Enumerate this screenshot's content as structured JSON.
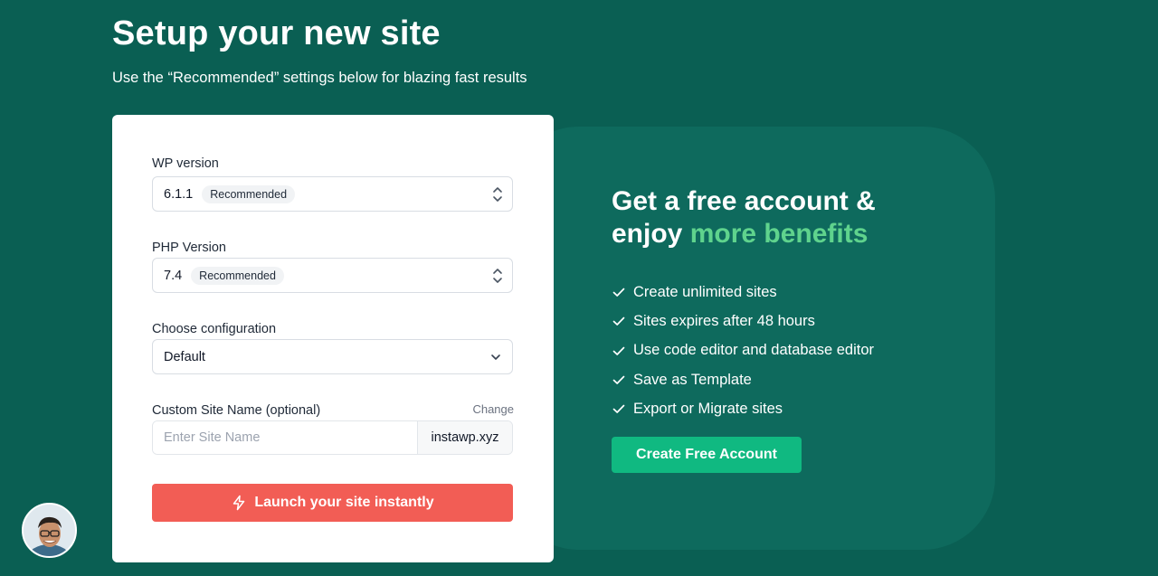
{
  "header": {
    "title": "Setup your new site",
    "subtitle": "Use the “Recommended” settings below for blazing fast results"
  },
  "form": {
    "wp_version": {
      "label": "WP version",
      "value": "6.1.1",
      "badge": "Recommended"
    },
    "php_version": {
      "label": "PHP Version",
      "value": "7.4",
      "badge": "Recommended"
    },
    "configuration": {
      "label": "Choose configuration",
      "value": "Default"
    },
    "site_name": {
      "label": "Custom Site Name (optional)",
      "change_link": "Change",
      "placeholder": "Enter Site Name",
      "domain_suffix": "instawp.xyz"
    },
    "launch_button": "Launch your site instantly"
  },
  "promo": {
    "heading_line1": "Get a free account &",
    "heading_line2_prefix": "enjoy ",
    "heading_line2_highlight": "more benefits",
    "benefits": [
      "Create unlimited sites",
      "Sites expires after 48 hours",
      "Use code editor and database editor",
      "Save as Template",
      "Export or Migrate sites"
    ],
    "cta_button": "Create Free Account"
  },
  "icons": {
    "select_arrows": "up-down-arrows-icon",
    "dropdown": "chevron-down-icon",
    "launch": "lightning-icon",
    "benefit": "check-icon",
    "avatar": "user-avatar"
  },
  "colors": {
    "background": "#0a5f53",
    "panel": "#0e6a5d",
    "highlight": "#5fd38d",
    "launch_button": "#f25d55",
    "cta_button": "#10b981"
  }
}
